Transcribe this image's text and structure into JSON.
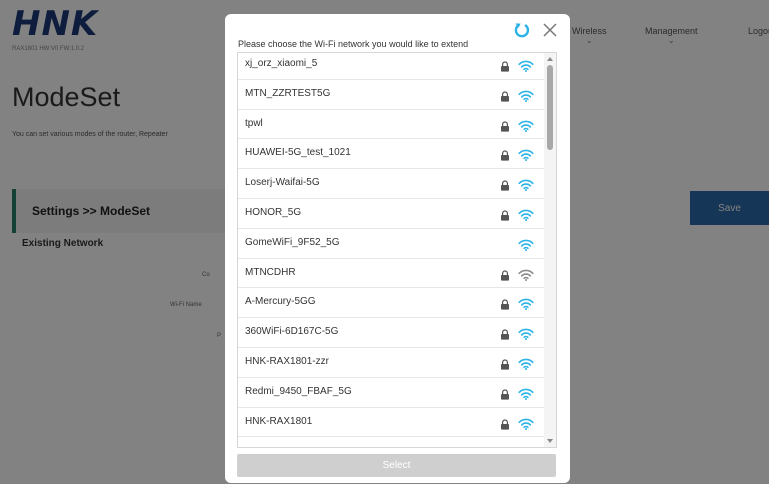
{
  "app": {
    "logo": "HNK",
    "model": "RAX1801 HW:V0 FW:1.0.2"
  },
  "nav": {
    "wireless": "Wireless",
    "management": "Management",
    "logout": "Logout"
  },
  "page": {
    "title": "ModeSet",
    "description": "You can set various modes of the router, Repeater",
    "section": "Settings >> ModeSet",
    "save_label": "Save",
    "existing_network": "Existing Network",
    "labels": [
      "Co",
      "Wi-Fi Name",
      "P"
    ]
  },
  "modal": {
    "title": "Please choose the Wi-Fi network you would like to extend",
    "select_label": "Select",
    "networks": [
      {
        "ssid": "xj_orz_xiaomi_5",
        "locked": true,
        "signal": "strong"
      },
      {
        "ssid": "MTN_ZZRTEST5G",
        "locked": true,
        "signal": "strong"
      },
      {
        "ssid": "tpwl",
        "locked": true,
        "signal": "strong"
      },
      {
        "ssid": "HUAWEI-5G_test_1021",
        "locked": true,
        "signal": "strong"
      },
      {
        "ssid": "Loserj-Waifai-5G",
        "locked": true,
        "signal": "strong"
      },
      {
        "ssid": "HONOR_5G",
        "locked": true,
        "signal": "strong"
      },
      {
        "ssid": "GomeWiFi_9F52_5G",
        "locked": false,
        "signal": "strong"
      },
      {
        "ssid": "MTNCDHR",
        "locked": true,
        "signal": "weak"
      },
      {
        "ssid": "A-Mercury-5GG",
        "locked": true,
        "signal": "strong"
      },
      {
        "ssid": "360WiFi-6D167C-5G",
        "locked": true,
        "signal": "strong"
      },
      {
        "ssid": "HNK-RAX1801-zzr",
        "locked": true,
        "signal": "strong"
      },
      {
        "ssid": "Redmi_9450_FBAF_5G",
        "locked": true,
        "signal": "strong"
      },
      {
        "ssid": "HNK-RAX1801",
        "locked": true,
        "signal": "strong"
      }
    ]
  },
  "colors": {
    "accent": "#2a6aa9",
    "logo": "#1c3a78",
    "wifi_strong": "#2ab3e6",
    "wifi_weak": "#8a8a8a",
    "refresh": "#2ab3e6"
  },
  "icons": {
    "refresh": "refresh-icon",
    "close": "close-icon",
    "lock": "lock-icon",
    "wifi": "wifi-icon"
  }
}
